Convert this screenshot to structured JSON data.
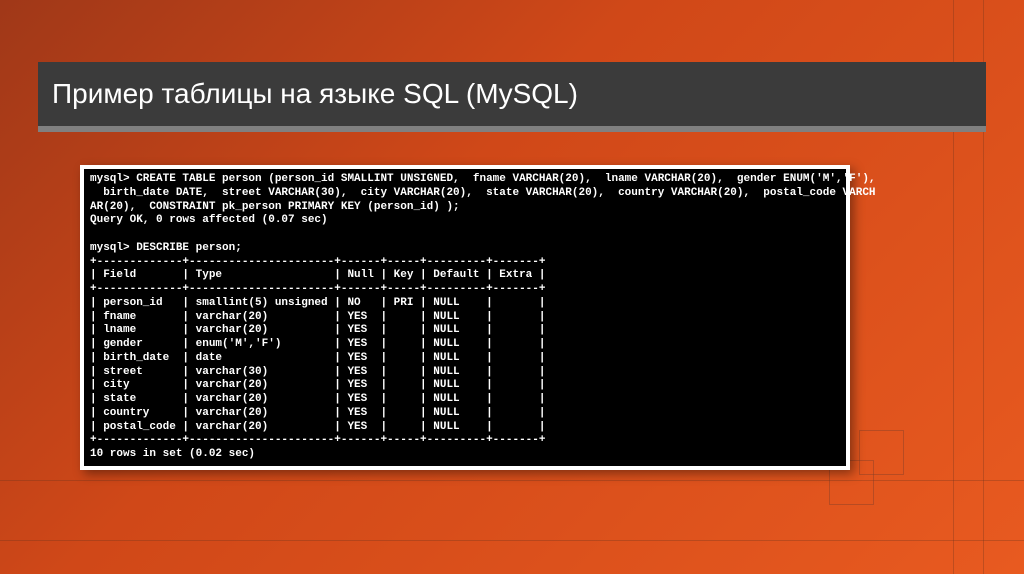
{
  "slide": {
    "title": "Пример таблицы на языке SQL (MySQL)"
  },
  "terminal": {
    "prompt": "mysql>",
    "create_statement": "CREATE TABLE person (person_id SMALLINT UNSIGNED,  fname VARCHAR(20),  lname VARCHAR(20),  gender ENUM('M','F'),",
    "create_line2": "  birth_date DATE,  street VARCHAR(30),  city VARCHAR(20),  state VARCHAR(20),  country VARCHAR(20),  postal_code VARCH",
    "create_line3": "AR(20),  CONSTRAINT pk_person PRIMARY KEY (person_id) );",
    "query_result": "Query OK, 0 rows affected (0.07 sec)",
    "describe_cmd": "DESCRIBE person;",
    "table_border": "+-------------+----------------------+------+-----+---------+-------+",
    "header": {
      "field": "Field",
      "type": "Type",
      "null": "Null",
      "key": "Key",
      "default": "Default",
      "extra": "Extra"
    },
    "rows": [
      {
        "field": "person_id",
        "type": "smallint(5) unsigned",
        "null": "NO",
        "key": "PRI",
        "default": "NULL",
        "extra": ""
      },
      {
        "field": "fname",
        "type": "varchar(20)",
        "null": "YES",
        "key": "",
        "default": "NULL",
        "extra": ""
      },
      {
        "field": "lname",
        "type": "varchar(20)",
        "null": "YES",
        "key": "",
        "default": "NULL",
        "extra": ""
      },
      {
        "field": "gender",
        "type": "enum('M','F')",
        "null": "YES",
        "key": "",
        "default": "NULL",
        "extra": ""
      },
      {
        "field": "birth_date",
        "type": "date",
        "null": "YES",
        "key": "",
        "default": "NULL",
        "extra": ""
      },
      {
        "field": "street",
        "type": "varchar(30)",
        "null": "YES",
        "key": "",
        "default": "NULL",
        "extra": ""
      },
      {
        "field": "city",
        "type": "varchar(20)",
        "null": "YES",
        "key": "",
        "default": "NULL",
        "extra": ""
      },
      {
        "field": "state",
        "type": "varchar(20)",
        "null": "YES",
        "key": "",
        "default": "NULL",
        "extra": ""
      },
      {
        "field": "country",
        "type": "varchar(20)",
        "null": "YES",
        "key": "",
        "default": "NULL",
        "extra": ""
      },
      {
        "field": "postal_code",
        "type": "varchar(20)",
        "null": "YES",
        "key": "",
        "default": "NULL",
        "extra": ""
      }
    ],
    "footer": "10 rows in set (0.02 sec)"
  }
}
